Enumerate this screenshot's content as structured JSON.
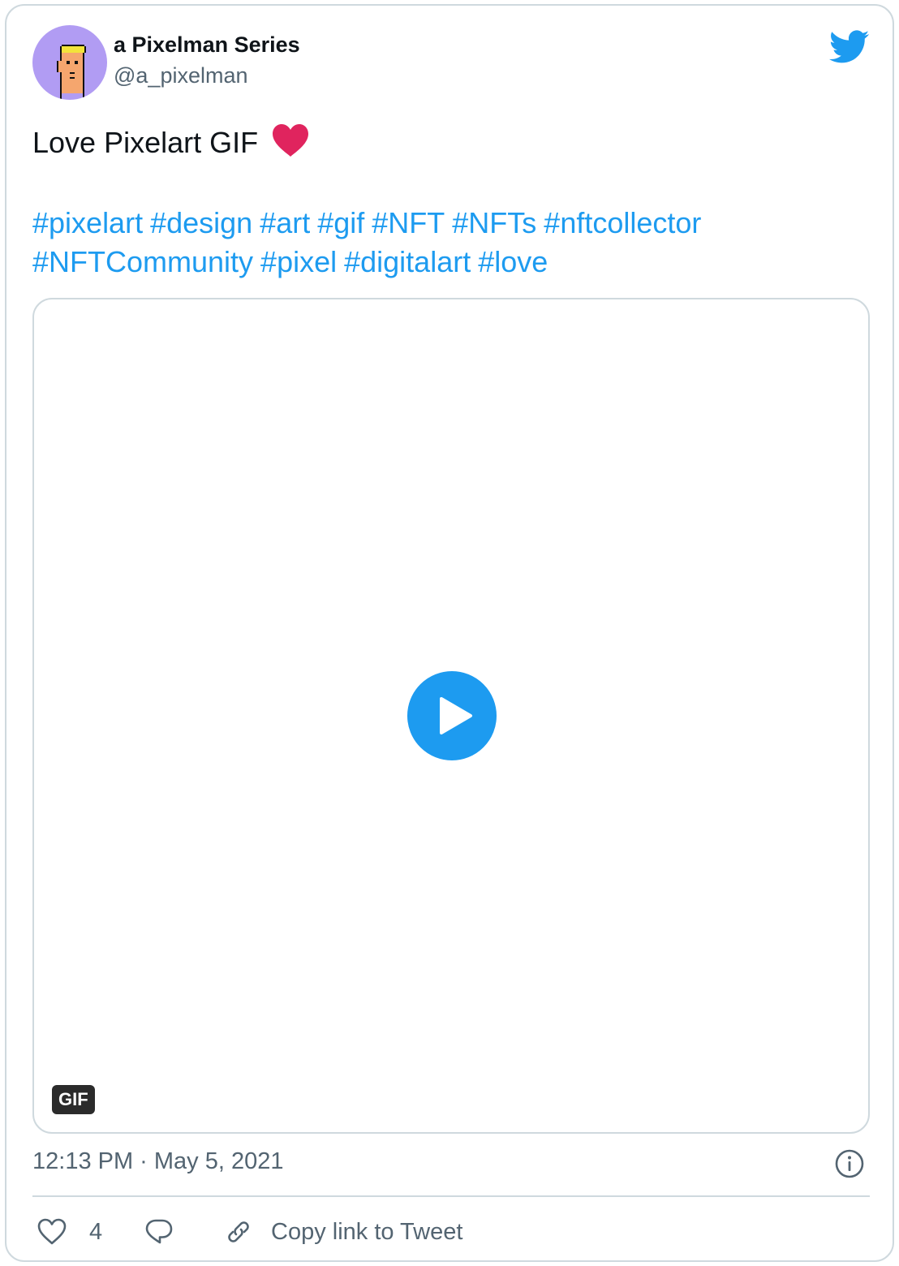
{
  "author": {
    "display_name": "a Pixelman Series",
    "handle": "@a_pixelman"
  },
  "tweet": {
    "text": "Love Pixelart GIF",
    "emoji": "red-heart",
    "hashtags": [
      "#pixelart",
      "#design",
      "#art",
      "#gif",
      "#NFT",
      "#NFTs",
      "#nftcollector",
      "#NFTCommunity",
      "#pixel",
      "#digitalart",
      "#love"
    ]
  },
  "media": {
    "badge": "GIF",
    "play_icon": "play-icon"
  },
  "meta": {
    "timestamp": "12:13 PM · May 5, 2021",
    "info_icon": "info-icon"
  },
  "actions": {
    "like_count": "4",
    "copy_link_label": "Copy link to Tweet"
  },
  "colors": {
    "accent": "#1d9bf0",
    "text": "#0f1419",
    "muted": "#536471",
    "border": "#cfd9de",
    "avatar_bg": "#b19cf3",
    "heart": "#e0245e"
  }
}
